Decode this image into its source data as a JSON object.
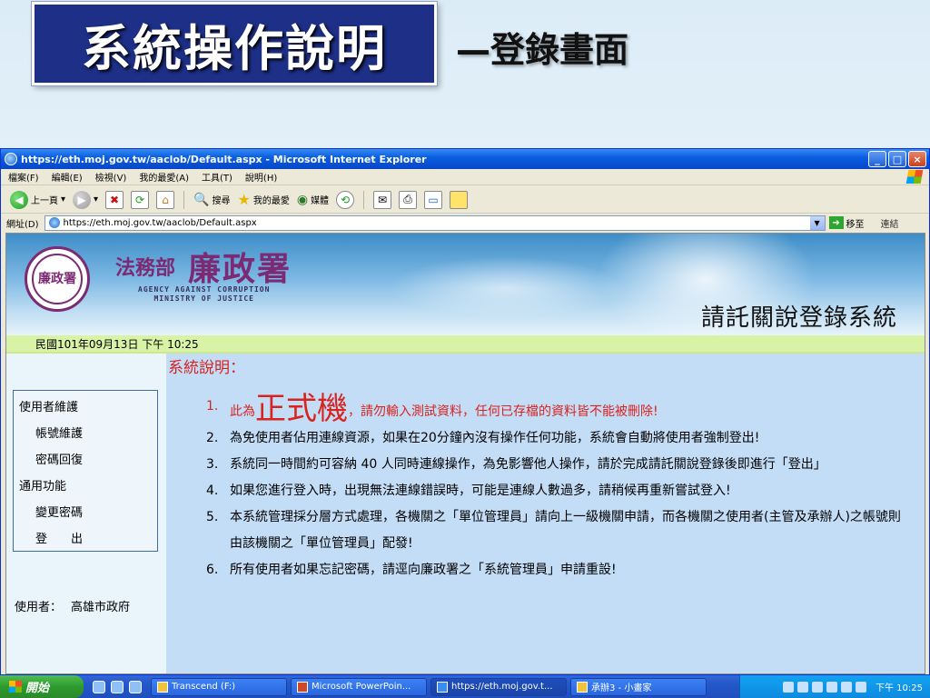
{
  "slide": {
    "title": "系統操作說明",
    "subtitle": "—登錄畫面"
  },
  "browser": {
    "title": "https://eth.moj.gov.tw/aaclob/Default.aspx - Microsoft Internet Explorer",
    "menu": [
      "檔案(F)",
      "編輯(E)",
      "檢視(V)",
      "我的最愛(A)",
      "工具(T)",
      "說明(H)"
    ],
    "toolbar": {
      "back": "上一頁",
      "search": "搜尋",
      "favorites": "我的最愛",
      "media": "媒體"
    },
    "address_label": "網址(D)",
    "address": "https://eth.moj.gov.tw/aaclob/Default.aspx",
    "go_label": "移至",
    "links_label": "連結"
  },
  "page": {
    "org": "法務部",
    "agency": "廉政署",
    "seal_text": "廉政署",
    "agency_en_1": "AGENCY AGAINST CORRUPTION",
    "agency_en_2": "MINISTRY OF JUSTICE",
    "system_name": "請託關說登錄系統",
    "date": "民國101年09月13日 下午 10:25",
    "menu": {
      "group1": "使用者維護",
      "item1": "帳號維護",
      "item2": "密碼回復",
      "group2": "通用功能",
      "item3": "變更密碼",
      "item4": "登　　出"
    },
    "user_label": "使用者：",
    "user_value": "高雄市政府",
    "heading": "系統說明：",
    "notes": {
      "n1_num": "1.",
      "n1_pre": "此為",
      "n1_big": "正式機",
      "n1_post": "，請勿輸入測試資料，任何已存檔的資料皆不能被刪除!",
      "n2_num": "2.",
      "n2": "為免使用者佔用連線資源，如果在20分鐘內沒有操作任何功能，系統會自動將使用者強制登出!",
      "n3_num": "3.",
      "n3": "系統同一時間約可容納 40 人同時連線操作，為免影響他人操作，請於完成請託關說登錄後即進行「登出」",
      "n4_num": "4.",
      "n4": "如果您進行登入時，出現無法連線錯誤時，可能是連線人數過多，請稍候再重新嘗試登入!",
      "n5_num": "5.",
      "n5": "本系統管理採分層方式處理，各機關之「單位管理員」請向上一級機關申請，而各機關之使用者(主管及承辦人)之帳號則由該機關之「單位管理員」配發!",
      "n6_num": "6.",
      "n6": "所有使用者如果忘記密碼，請逕向廉政署之「系統管理員」申請重設!"
    }
  },
  "taskbar": {
    "start": "開始",
    "tasks": [
      "Transcend (F:)",
      "Microsoft PowerPoin...",
      "https://eth.moj.gov.t...",
      "承辦3 - 小畫家"
    ],
    "clock": "下午 10:25"
  },
  "colors": {
    "title_box": "#1d2f86",
    "heading_red": "#d8231f",
    "date_bar": "#d8f2a6",
    "main_bg": "#c4ddf6",
    "brand_purple": "#7b2a73"
  }
}
